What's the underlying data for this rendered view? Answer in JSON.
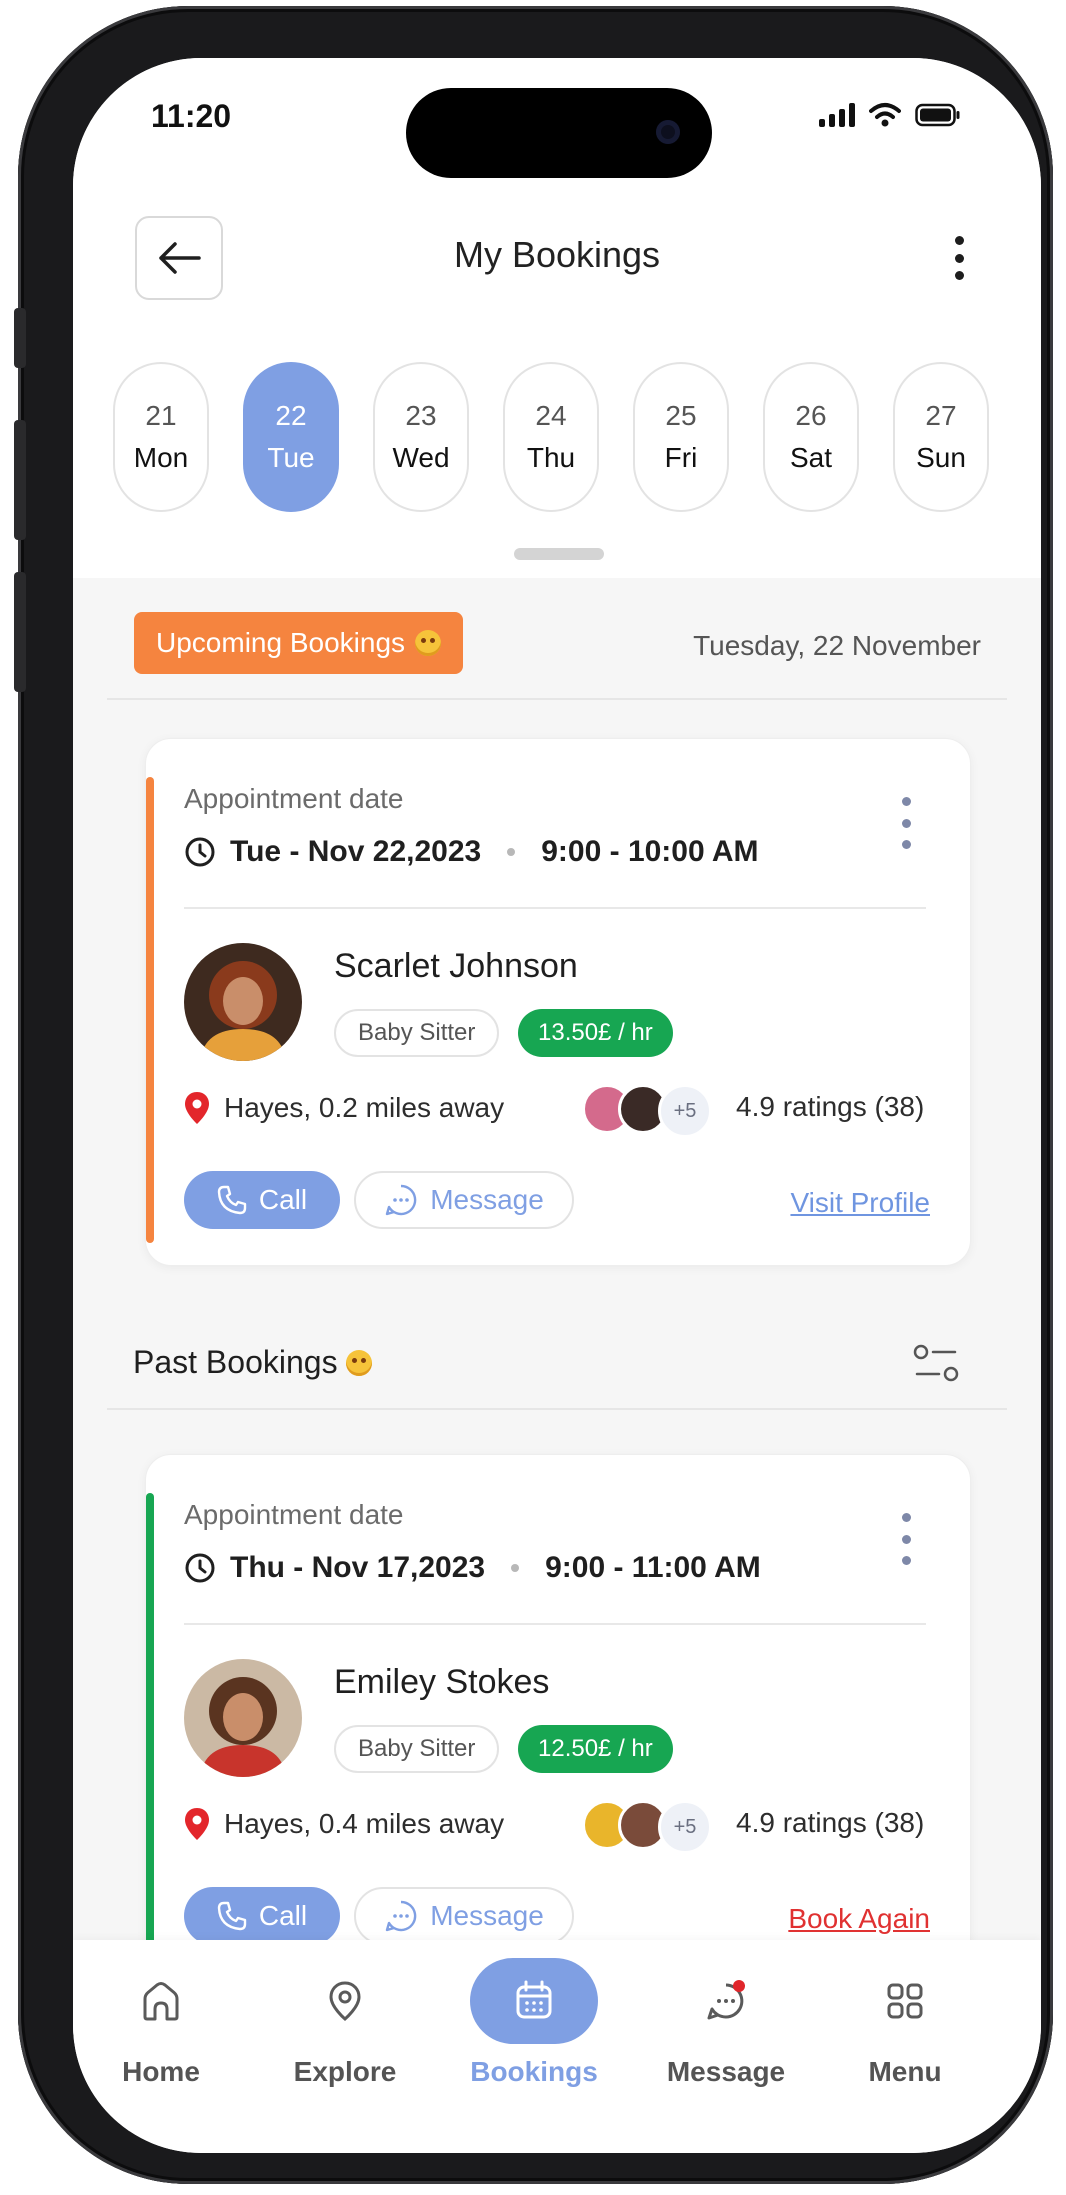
{
  "status_bar": {
    "time": "11:20"
  },
  "header": {
    "title": "My Bookings"
  },
  "dates": [
    {
      "num": "21",
      "day": "Mon",
      "active": false
    },
    {
      "num": "22",
      "day": "Tue",
      "active": true
    },
    {
      "num": "23",
      "day": "Wed",
      "active": false
    },
    {
      "num": "24",
      "day": "Thu",
      "active": false
    },
    {
      "num": "25",
      "day": "Fri",
      "active": false
    },
    {
      "num": "26",
      "day": "Sat",
      "active": false
    },
    {
      "num": "27",
      "day": "Sun",
      "active": false
    }
  ],
  "upcoming": {
    "badge": "Upcoming Bookings",
    "date_label": "Tuesday, 22 November",
    "card": {
      "appt_label": "Appointment date",
      "date": "Tue - Nov 22,2023",
      "time": "9:00 - 10:00 AM",
      "name": "Scarlet Johnson",
      "role": "Baby Sitter",
      "rate": "13.50£ / hr",
      "location": "Hayes, 0.2 miles away",
      "extra_count": "+5",
      "rating": "4.9 ratings (38)",
      "call_label": "Call",
      "message_label": "Message",
      "link_label": "Visit Profile"
    }
  },
  "past": {
    "title": "Past Bookings",
    "card": {
      "appt_label": "Appointment date",
      "date": "Thu - Nov 17,2023",
      "time": "9:00 - 11:00 AM",
      "name": "Emiley Stokes",
      "role": "Baby Sitter",
      "rate": "12.50£ / hr",
      "location": "Hayes, 0.4 miles away",
      "extra_count": "+5",
      "rating": "4.9 ratings (38)",
      "call_label": "Call",
      "message_label": "Message",
      "link_label": "Book Again"
    }
  },
  "nav": [
    {
      "label": "Home",
      "icon": "home-icon",
      "active": false
    },
    {
      "label": "Explore",
      "icon": "location-pin-icon",
      "active": false
    },
    {
      "label": "Bookings",
      "icon": "calendar-icon",
      "active": true
    },
    {
      "label": "Message",
      "icon": "chat-bubble-icon",
      "active": false
    },
    {
      "label": "Menu",
      "icon": "grid-menu-icon",
      "active": false
    }
  ],
  "colors": {
    "accent": "#7f9fe3",
    "upcoming_bar": "#f5843f",
    "past_bar": "#17a652",
    "rate_tag": "#17a652",
    "visit_link": "#6f95e0",
    "book_again_link": "#e03131",
    "location_pin": "#e3262b"
  }
}
